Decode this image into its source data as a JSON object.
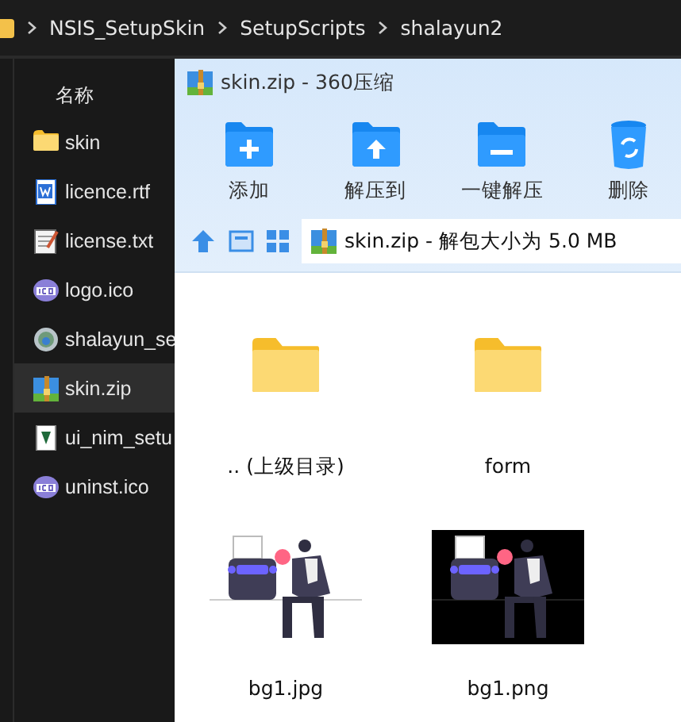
{
  "breadcrumb": [
    "NSIS_SetupSkin",
    "SetupScripts",
    "shalayun2"
  ],
  "explorer": {
    "column_header": "名称",
    "files": [
      {
        "name": "skin",
        "kind": "folder",
        "selected": false
      },
      {
        "name": "licence.rtf",
        "kind": "rtf",
        "selected": false
      },
      {
        "name": "license.txt",
        "kind": "txt",
        "selected": false
      },
      {
        "name": "logo.ico",
        "kind": "ico",
        "selected": false
      },
      {
        "name": "shalayun_se",
        "kind": "exe",
        "selected": false
      },
      {
        "name": "skin.zip",
        "kind": "zip",
        "selected": true
      },
      {
        "name": "ui_nim_setu",
        "kind": "nim",
        "selected": false
      },
      {
        "name": "uninst.ico",
        "kind": "ico",
        "selected": false
      }
    ]
  },
  "archive_window": {
    "title": "skin.zip - 360压缩",
    "toolbar": [
      {
        "label": "添加",
        "kind": "add"
      },
      {
        "label": "解压到",
        "kind": "extract"
      },
      {
        "label": "一键解压",
        "kind": "oneclick"
      },
      {
        "label": "删除",
        "kind": "delete"
      }
    ],
    "address": "skin.zip - 解包大小为 5.0 MB",
    "items": [
      {
        "name": ".. (上级目录)",
        "kind": "folder"
      },
      {
        "name": "form",
        "kind": "folder"
      },
      {
        "name": "bg1.jpg",
        "kind": "image",
        "dark": false
      },
      {
        "name": "bg1.png",
        "kind": "image",
        "dark": true
      }
    ]
  }
}
